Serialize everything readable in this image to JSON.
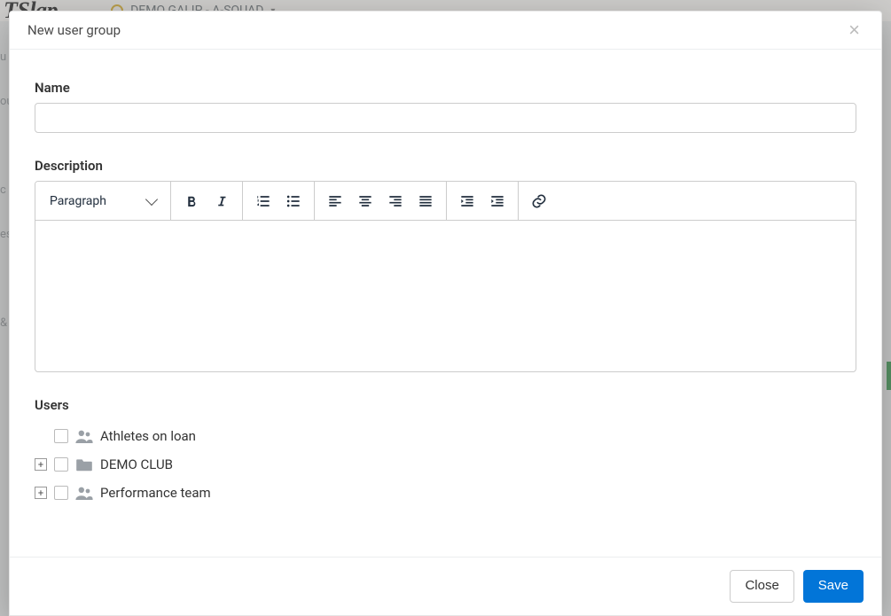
{
  "background": {
    "brand_fragment": "TSlap",
    "team_label": "DEMO GALIP - A-SQUAD"
  },
  "modal": {
    "title": "New user group",
    "labels": {
      "name": "Name",
      "description": "Description",
      "users": "Users"
    },
    "name_value": "",
    "editor": {
      "format_label": "Paragraph",
      "content": ""
    },
    "users_tree": [
      {
        "label": "Athletes on loan",
        "expandable": false,
        "icon": "group"
      },
      {
        "label": "DEMO CLUB",
        "expandable": true,
        "icon": "folder"
      },
      {
        "label": "Performance team",
        "expandable": true,
        "icon": "group"
      }
    ],
    "buttons": {
      "close": "Close",
      "save": "Save"
    }
  }
}
